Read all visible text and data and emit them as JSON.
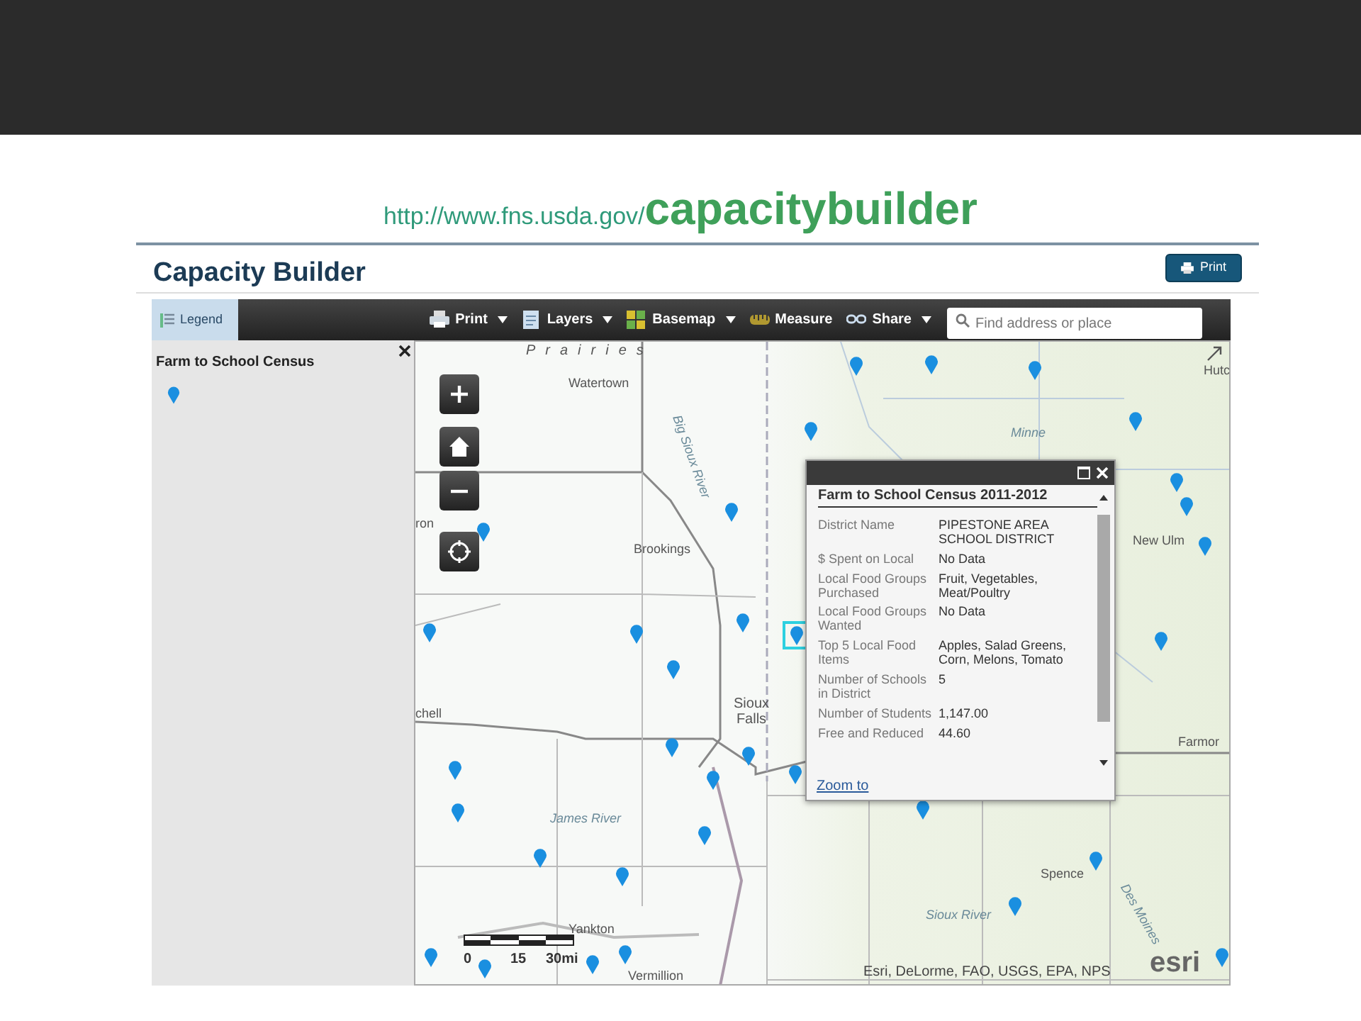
{
  "slide": {
    "url_prefix": "http://www.fns.usda.gov/",
    "url_path": "capacitybuilder"
  },
  "app": {
    "title": "Capacity Builder",
    "print_button": "Print"
  },
  "toolbar": {
    "legend_button": {
      "label": "Legend",
      "selected": true
    },
    "items": [
      {
        "kind": "print",
        "label": "Print",
        "has_menu": true
      },
      {
        "kind": "layers",
        "label": "Layers",
        "has_menu": true
      },
      {
        "kind": "basemap",
        "label": "Basemap",
        "has_menu": true
      },
      {
        "kind": "measure",
        "label": "Measure",
        "has_menu": false
      },
      {
        "kind": "share",
        "label": "Share",
        "has_menu": true
      }
    ],
    "search": {
      "placeholder": "Find address or place"
    }
  },
  "legend_panel": {
    "layer_title": "Farm to School Census"
  },
  "map": {
    "labels": [
      "Prairies",
      "Watertown",
      "Big Sioux River",
      "ron",
      "Brookings",
      "chell",
      "Sioux Falls",
      "James River",
      "Yankton",
      "Vermillion",
      "Sioux River",
      "Spence",
      "Des Moines",
      "New Ulm",
      "Hutc",
      "Farmor",
      "Minne"
    ],
    "scale_labels": [
      "0",
      "15",
      "30mi"
    ],
    "attribution": "Esri, DeLorme, FAO, USGS, EPA, NPS",
    "logo": "esri",
    "pins": [
      {
        "selected": false
      },
      {
        "selected": false
      },
      {
        "selected": false
      },
      {
        "selected": false
      },
      {
        "selected": false
      },
      {
        "selected": false
      },
      {
        "selected": false
      },
      {
        "selected": false
      },
      {
        "selected": false
      },
      {
        "selected": false
      },
      {
        "selected": false
      },
      {
        "selected": false
      },
      {
        "selected": false
      },
      {
        "selected": false
      },
      {
        "selected": false
      },
      {
        "selected": true
      },
      {
        "selected": false
      },
      {
        "selected": false
      },
      {
        "selected": false
      },
      {
        "selected": false
      },
      {
        "selected": false
      },
      {
        "selected": false
      },
      {
        "selected": false
      },
      {
        "selected": false
      },
      {
        "selected": false
      },
      {
        "selected": false
      },
      {
        "selected": false
      },
      {
        "selected": false
      },
      {
        "selected": false
      },
      {
        "selected": false
      },
      {
        "selected": false
      },
      {
        "selected": false
      },
      {
        "selected": false
      }
    ]
  },
  "popup": {
    "title": "Farm to School Census 2011-2012",
    "rows": [
      {
        "label": "District Name",
        "value": "PIPESTONE AREA SCHOOL DISTRICT"
      },
      {
        "label": "$ Spent on Local",
        "value": "No Data"
      },
      {
        "label": "Local Food Groups Purchased",
        "value": "Fruit, Vegetables, Meat/Poultry"
      },
      {
        "label": "Local Food Groups Wanted",
        "value": "No Data"
      },
      {
        "label": "Top 5 Local Food Items",
        "value": "Apples, Salad Greens, Corn, Melons, Tomato"
      },
      {
        "label": "Number of Schools in District",
        "value": "5"
      },
      {
        "label": "Number of Students",
        "value": "1,147.00"
      },
      {
        "label": "Free and Reduced",
        "value": "44.60"
      }
    ],
    "link": "Zoom to"
  }
}
